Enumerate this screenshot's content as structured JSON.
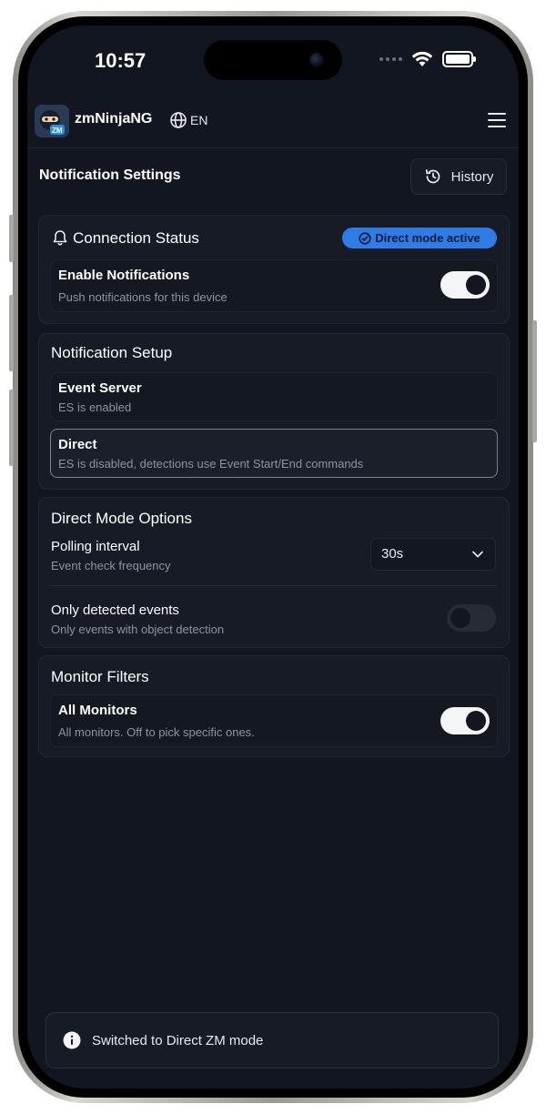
{
  "status_bar": {
    "time": "10:57"
  },
  "app": {
    "name": "zmNinjaNG",
    "language": "EN"
  },
  "page": {
    "title": "Notification Settings",
    "history_label": "History"
  },
  "connection_status": {
    "title": "Connection Status",
    "badge": "Direct mode active",
    "enable_notifications": {
      "label": "Enable Notifications",
      "description": "Push notifications for this device",
      "enabled": true
    }
  },
  "notification_setup": {
    "title": "Notification Setup",
    "options": [
      {
        "label": "Event Server",
        "description": "ES is enabled",
        "selected": false
      },
      {
        "label": "Direct",
        "description": "ES is disabled, detections use Event Start/End commands",
        "selected": true
      }
    ]
  },
  "direct_mode_options": {
    "title": "Direct Mode Options",
    "polling": {
      "label": "Polling interval",
      "description": "Event check frequency",
      "value": "30s"
    },
    "only_detected": {
      "label": "Only detected events",
      "description": "Only events with object detection",
      "enabled": false
    }
  },
  "monitor_filters": {
    "title": "Monitor Filters",
    "all_monitors": {
      "label": "All Monitors",
      "description": "All monitors. Off to pick specific ones.",
      "enabled": true
    }
  },
  "toast": {
    "message": "Switched to Direct ZM mode"
  },
  "colors": {
    "background": "#121620",
    "card": "#171b25",
    "accent": "#2f7ce6",
    "text_muted": "#8d94a1"
  }
}
